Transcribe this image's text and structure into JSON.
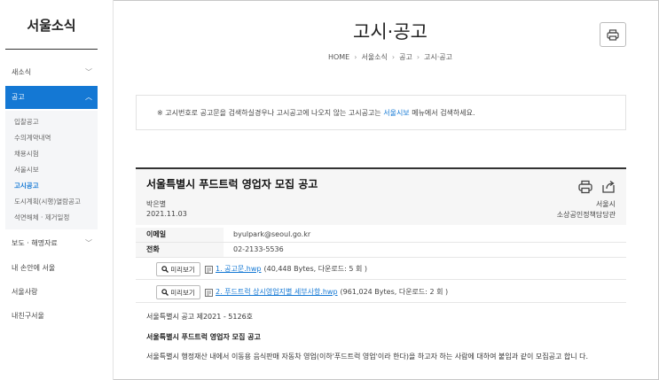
{
  "sidebar": {
    "title": "서울소식",
    "items": [
      {
        "label": "새소식",
        "chev": "﹀"
      },
      {
        "label": "공고",
        "chev": "︿"
      },
      {
        "label": "보도 · 해명자료",
        "chev": "﹀"
      },
      {
        "label": "내 손안에 서울"
      },
      {
        "label": "서울사랑"
      },
      {
        "label": "내친구서울"
      }
    ],
    "subitems": [
      "입찰공고",
      "수의계약내역",
      "채용시험",
      "서울시보",
      "고시공고",
      "도시계획(시행)열람공고",
      "석면해체 · 제거일정"
    ]
  },
  "header": {
    "title": "고시·공고",
    "breadcrumb": [
      "HOME",
      "서울소식",
      "공고",
      "고시·공고"
    ],
    "sep": "›"
  },
  "notice": {
    "prefix": "※ 고시번호로 공고문을 검색하실경우나 고시공고에 나오지 않는 고시공고는 ",
    "link": "서울시보",
    "suffix": " 메뉴에서 검색하세요."
  },
  "article": {
    "title": "서울특별시 푸드트럭 영업자 모집 공고",
    "author": "박은별",
    "date": "2021.11.03",
    "org": "서울시",
    "dept": "소상공인정책담당관",
    "email_label": "이메일",
    "email": "byulpark@seoul.go.kr",
    "phone_label": "전화",
    "phone": "02-2133-5536",
    "preview_label": "미리보기",
    "files": [
      {
        "name": "1. 공고문.hwp",
        "meta": "(40,448 Bytes, 다운로드: 5 회 )"
      },
      {
        "name": "2. 푸드트럭 상시영업지별 세부사항.hwp",
        "meta": "(961,024 Bytes, 다운로드: 2 회 )"
      }
    ],
    "body": {
      "line1": "서울특별시 공고 제2021 - 5126호",
      "line2": "서울특별시 푸드트럭 영업자 모집 공고",
      "line3": "서울특별시 행정재산 내에서 이동용 음식판매 자동차 영업(이하'푸드트럭 영업'이라 한다)을 하고자 하는 사람에 대하여 붙임과 같이 모집공고 합니 다."
    }
  },
  "colors": {
    "accent": "#1478d4"
  }
}
